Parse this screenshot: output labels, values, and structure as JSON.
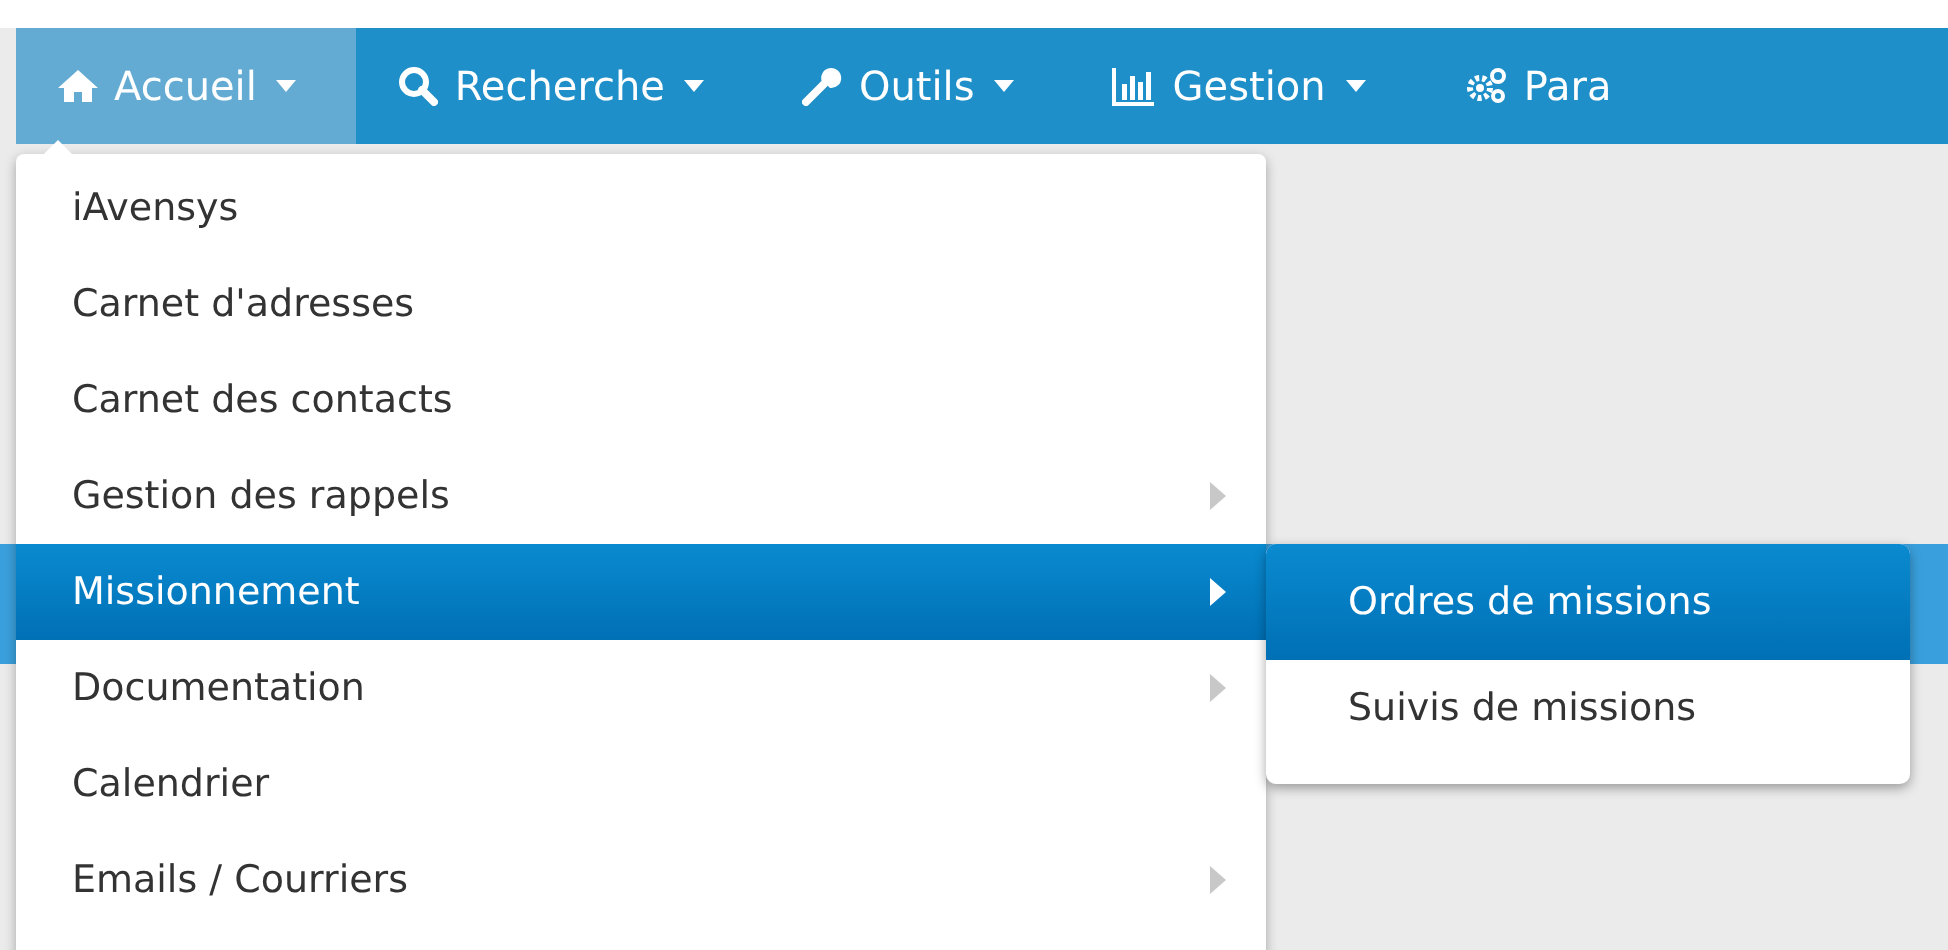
{
  "navbar": {
    "items": [
      {
        "label": "Accueil",
        "caret": true,
        "selected": true
      },
      {
        "label": "Recherche",
        "caret": true,
        "selected": false
      },
      {
        "label": "Outils",
        "caret": true,
        "selected": false
      },
      {
        "label": "Gestion",
        "caret": true,
        "selected": false
      },
      {
        "label": "Para",
        "caret": false,
        "selected": false
      }
    ]
  },
  "dropdown": {
    "items": [
      {
        "label": "iAvensys",
        "submenu": false,
        "selected": false
      },
      {
        "label": "Carnet d'adresses",
        "submenu": false,
        "selected": false
      },
      {
        "label": "Carnet des contacts",
        "submenu": false,
        "selected": false
      },
      {
        "label": "Gestion des rappels",
        "submenu": true,
        "selected": false
      },
      {
        "label": "Missionnement",
        "submenu": true,
        "selected": true
      },
      {
        "label": "Documentation",
        "submenu": true,
        "selected": false
      },
      {
        "label": "Calendrier",
        "submenu": false,
        "selected": false
      },
      {
        "label": "Emails / Courriers",
        "submenu": true,
        "selected": false
      }
    ]
  },
  "submenu": {
    "items": [
      {
        "label": "Ordres de missions",
        "selected": true
      },
      {
        "label": "Suivis de missions",
        "selected": false
      }
    ]
  }
}
